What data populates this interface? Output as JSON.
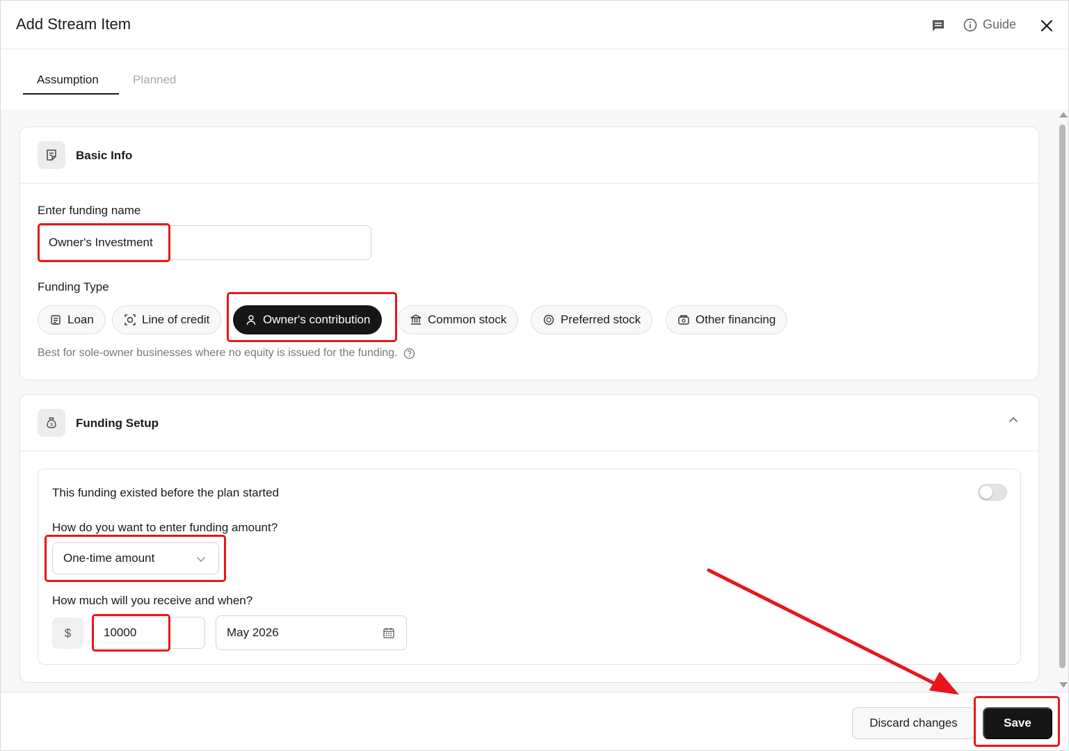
{
  "header": {
    "title": "Add Stream Item",
    "guide_label": "Guide"
  },
  "tabs": [
    {
      "label": "Assumption",
      "active": true
    },
    {
      "label": "Planned",
      "active": false
    }
  ],
  "basic_info": {
    "title": "Basic Info",
    "funding_name_label": "Enter funding name",
    "funding_name_value": "Owner's Investment",
    "funding_type_label": "Funding Type",
    "funding_types": [
      {
        "label": "Loan",
        "icon": "loan-icon",
        "selected": false
      },
      {
        "label": "Line of credit",
        "icon": "line-of-credit-icon",
        "selected": false
      },
      {
        "label": "Owner's contribution",
        "icon": "person-icon",
        "selected": true
      },
      {
        "label": "Common stock",
        "icon": "bank-icon",
        "selected": false
      },
      {
        "label": "Preferred stock",
        "icon": "coin-icon",
        "selected": false
      },
      {
        "label": "Other financing",
        "icon": "wallet-icon",
        "selected": false
      }
    ],
    "hint": "Best for sole-owner businesses where no equity is issued for the funding."
  },
  "funding_setup": {
    "title": "Funding Setup",
    "existed_label": "This funding existed before the plan started",
    "existed_toggle": false,
    "amount_method_label": "How do you want to enter funding amount?",
    "amount_method_value": "One-time amount",
    "receive_label": "How much will you receive and when?",
    "currency_symbol": "$",
    "amount_value": "10000",
    "date_value": "May 2026"
  },
  "footer": {
    "discard_label": "Discard changes",
    "save_label": "Save"
  },
  "colors": {
    "accent_dark": "#161616",
    "highlight_red": "#e8161b"
  }
}
